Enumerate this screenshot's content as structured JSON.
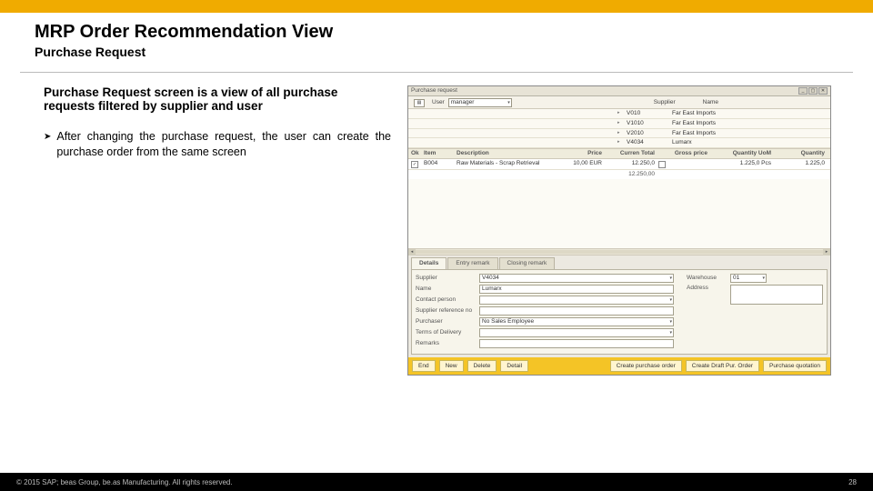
{
  "slide": {
    "title": "MRP Order Recommendation View",
    "subtitle": "Purchase Request",
    "intro": "Purchase Request screen is a view of all purchase requests filtered by supplier and user",
    "bullet1": "After changing the purchase request, the user can create the purchase order from the same screen"
  },
  "app": {
    "window_title": "Purchase request",
    "filter": {
      "user_label": "User",
      "user_value": "manager",
      "supplier_label": "Supplier",
      "name_label": "Name"
    },
    "suppliers": [
      {
        "code": "V010",
        "name": "Far East Imports"
      },
      {
        "code": "V1010",
        "name": "Far East Imports"
      },
      {
        "code": "V2010",
        "name": "Far East Imports"
      },
      {
        "code": "V4034",
        "name": "Lumarx"
      }
    ],
    "grid_headers": {
      "ok": "Ok",
      "item": "Item",
      "desc": "Description",
      "price": "Price",
      "curr": "Curren Total",
      "gross": "Gross price",
      "qty_uom": "Quantity UoM",
      "qty": "Quantity"
    },
    "grid_row": {
      "item": "B004",
      "desc": "Raw Materials - Scrap Retrieval",
      "price": "10,00 EUR",
      "total": "12.250,0",
      "gross_chk": false,
      "qty_uom": "1.225,0 Pcs",
      "qty": "1.225,0"
    },
    "grid_sum": "12.250,00",
    "tabs": {
      "details": "Details",
      "entry": "Entry remark",
      "closing": "Closing remark"
    },
    "details": {
      "supplier_label": "Supplier",
      "supplier_value": "V4034",
      "name_label": "Name",
      "name_value": "Lumarx",
      "contact_label": "Contact person",
      "ref_label": "Supplier reference no",
      "purchaser_label": "Purchaser",
      "purchaser_value": "No Sales Employee",
      "terms_label": "Terms of Delivery",
      "remarks_label": "Remarks",
      "warehouse_label": "Warehouse",
      "warehouse_value": "01",
      "address_label": "Address"
    },
    "buttons": {
      "end": "End",
      "new": "New",
      "delete": "Delete",
      "detail": "Detail",
      "create_po": "Create purchase order",
      "create_draft": "Create Draft Pur. Order",
      "quotation": "Purchase quotation"
    }
  },
  "footer": {
    "copyright": "© 2015 SAP; beas Group, be.as Manufacturing. All rights reserved.",
    "page": "28"
  }
}
